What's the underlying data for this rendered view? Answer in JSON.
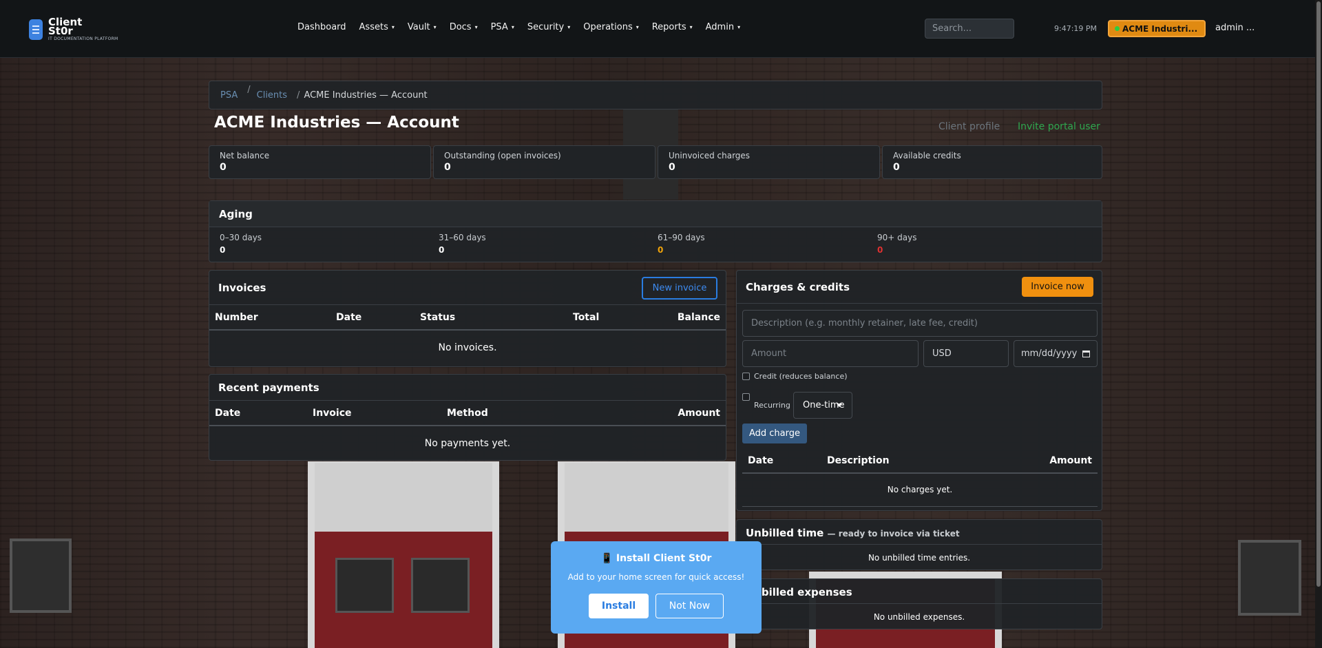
{
  "app": {
    "logo_title": "Client St0r",
    "logo_subtitle": "IT DOCUMENTATION PLATFORM"
  },
  "nav": {
    "items": [
      {
        "label": "Dashboard",
        "dropdown": false
      },
      {
        "label": "Assets",
        "dropdown": true
      },
      {
        "label": "Vault",
        "dropdown": true
      },
      {
        "label": "Docs",
        "dropdown": true
      },
      {
        "label": "PSA",
        "dropdown": true
      },
      {
        "label": "Security",
        "dropdown": true
      },
      {
        "label": "Operations",
        "dropdown": true
      },
      {
        "label": "Reports",
        "dropdown": true
      },
      {
        "label": "Admin",
        "dropdown": true
      }
    ],
    "caret": "▾",
    "search_placeholder": "Search...",
    "clock": "9:47:19 PM",
    "client_pill": "ACME Industri...",
    "user": "admin ..."
  },
  "breadcrumb": {
    "items": [
      "PSA",
      "Clients",
      "ACME Industries — Account"
    ],
    "sep": "/"
  },
  "page": {
    "title": "ACME Industries — Account",
    "client_profile_link": "Client profile",
    "invite_link": "Invite portal user"
  },
  "stats": [
    {
      "label": "Net balance",
      "value": "0"
    },
    {
      "label": "Outstanding (open invoices)",
      "value": "0"
    },
    {
      "label": "Uninvoiced charges",
      "value": "0"
    },
    {
      "label": "Available credits",
      "value": "0"
    }
  ],
  "aging": {
    "title": "Aging",
    "buckets": [
      {
        "label": "0–30 days",
        "value": "0",
        "color": "#ffffff"
      },
      {
        "label": "31–60 days",
        "value": "0",
        "color": "#ffffff"
      },
      {
        "label": "61–90 days",
        "value": "0",
        "color": "#f0a30a"
      },
      {
        "label": "90+ days",
        "value": "0",
        "color": "#e03131"
      }
    ]
  },
  "invoices": {
    "title": "Invoices",
    "new_button": "New invoice",
    "columns": [
      "Number",
      "Date",
      "Status",
      "Total",
      "Balance"
    ],
    "empty": "No invoices."
  },
  "payments": {
    "title": "Recent payments",
    "columns": [
      "Date",
      "Invoice",
      "Method",
      "Amount"
    ],
    "empty": "No payments yet."
  },
  "charges": {
    "title": "Charges & credits",
    "invoice_now": "Invoice now",
    "description_placeholder": "Description (e.g. monthly retainer, late fee, credit)",
    "amount_placeholder": "Amount",
    "currency": "USD",
    "date_placeholder": "mm/dd/yyyy",
    "credit_label": "Credit (reduces balance)",
    "recurring_label": "Recurring",
    "frequency": "One-time",
    "add_button": "Add charge",
    "columns": [
      "Date",
      "Description",
      "Amount"
    ],
    "empty": "No charges yet."
  },
  "unbilled_time": {
    "title": "Unbilled time",
    "subtitle": "— ready to invoice via ticket",
    "empty": "No unbilled time entries."
  },
  "unbilled_expenses": {
    "title": "Unbilled expenses",
    "empty": "No unbilled expenses."
  },
  "install_prompt": {
    "title": "📱 Install Client St0r",
    "text": "Add to your home screen for quick access!",
    "install": "Install",
    "not_now": "Not Now"
  },
  "colors": {
    "accent_blue": "#2a7de1",
    "warning": "#f0900f",
    "success": "#2fa84f",
    "danger": "#e03131"
  }
}
